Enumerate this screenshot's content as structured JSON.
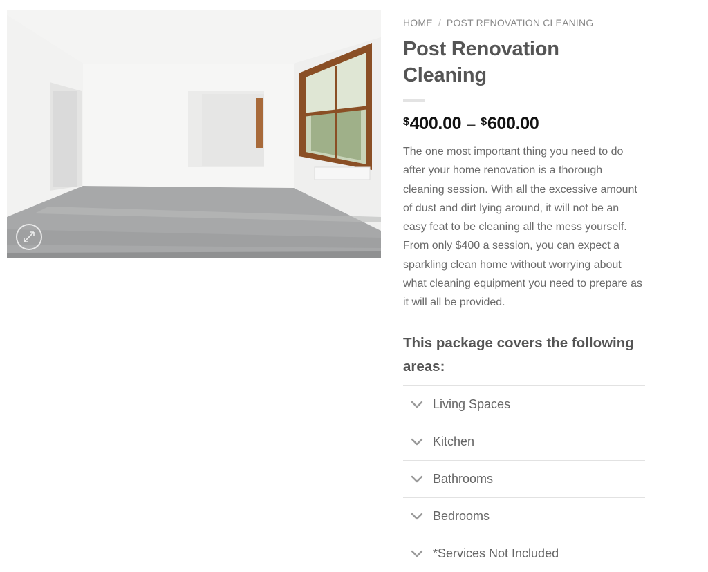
{
  "breadcrumb": {
    "home": "HOME",
    "separator": "/",
    "current": "POST RENOVATION CLEANING"
  },
  "product": {
    "title": "Post Renovation Cleaning",
    "price": {
      "currency": "$",
      "min": "400.00",
      "dash": "–",
      "max": "600.00"
    },
    "description": "The one most important thing you need to do after your home renovation is a thorough cleaning session. With all the excessive amount of dust and dirt lying around, it will not be an easy feat to be cleaning all the mess yourself. From only $400 a session, you can expect a sparkling clean home without worrying about what cleaning equipment you need to prepare as it will all be provided.",
    "covers_heading": "This package covers the following areas:"
  },
  "accordion": [
    {
      "label": "Living Spaces",
      "icon": "chevron-down-icon"
    },
    {
      "label": "Kitchen",
      "icon": "chevron-down-icon"
    },
    {
      "label": "Bathrooms",
      "icon": "chevron-down-icon"
    },
    {
      "label": "Bedrooms",
      "icon": "chevron-down-icon"
    },
    {
      "label": "*Services Not Included",
      "icon": "chevron-down-icon"
    }
  ],
  "gallery": {
    "zoom_icon": "expand-icon"
  }
}
